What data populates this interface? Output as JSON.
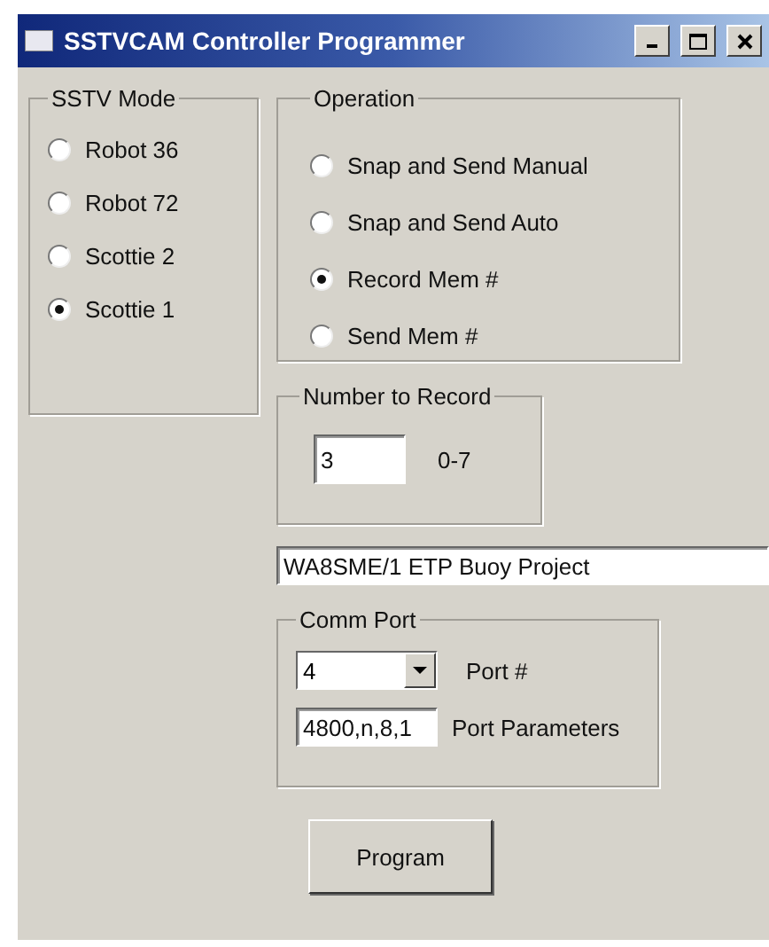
{
  "window": {
    "title": "SSTVCAM Controller Programmer"
  },
  "sstv_mode": {
    "label": "SSTV Mode",
    "options": [
      {
        "label": "Robot 36",
        "selected": false
      },
      {
        "label": "Robot 72",
        "selected": false
      },
      {
        "label": "Scottie 2",
        "selected": false
      },
      {
        "label": "Scottie 1",
        "selected": true
      }
    ]
  },
  "operation": {
    "label": "Operation",
    "options": [
      {
        "label": "Snap and Send Manual",
        "selected": false
      },
      {
        "label": "Snap and Send Auto",
        "selected": false
      },
      {
        "label": "Record Mem #",
        "selected": true
      },
      {
        "label": "Send Mem #",
        "selected": false
      }
    ]
  },
  "number_to_record": {
    "label": "Number to Record",
    "value": "3",
    "range": "0-7"
  },
  "project_field": {
    "value": "WA8SME/1 ETP Buoy Project"
  },
  "comm_port": {
    "label": "Comm Port",
    "port": {
      "value": "4",
      "label": "Port #"
    },
    "parameters": {
      "value": "4800,n,8,1",
      "label": "Port Parameters"
    }
  },
  "buttons": [
    "Program"
  ]
}
